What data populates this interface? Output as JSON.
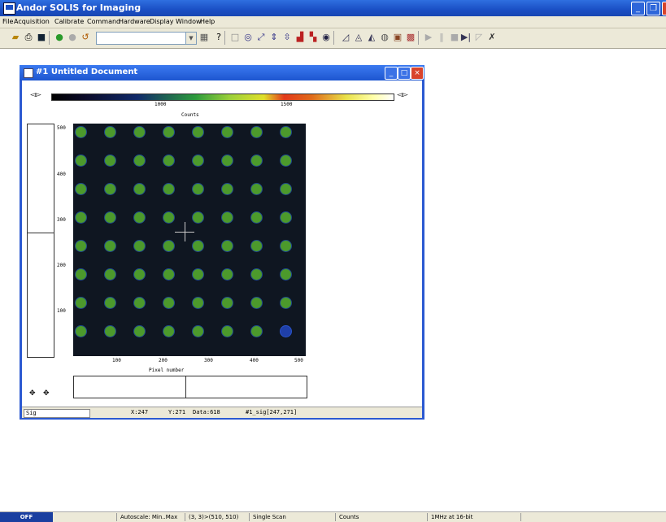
{
  "app": {
    "title": "Andor SOLIS for Imaging"
  },
  "menu": [
    "File",
    "Acquisition",
    "Calibrate",
    "Command",
    "Hardware",
    "Display",
    "Window",
    "Help"
  ],
  "document": {
    "title": "#1  Untitled Document",
    "colorbar_ticks": [
      "1000",
      "1500"
    ],
    "colorbar_label": "Counts",
    "y_ticks": [
      "500",
      "400",
      "300",
      "200",
      "100"
    ],
    "x_ticks": [
      "100",
      "200",
      "300",
      "400",
      "500"
    ],
    "x_label": "Pixel number",
    "status": {
      "sig": "Sig",
      "x": "X:247",
      "y": "Y:271",
      "data": "Data:618",
      "ref": "#1_sig[247,271]"
    }
  },
  "status_bar": {
    "mode": "OFF",
    "autoscale": "Autoscale: Min..Max",
    "region": "(3, 3)>(510, 510)",
    "scan": "Single Scan",
    "units": "Counts",
    "readout": "1MHz at 16-bit"
  },
  "colors": {
    "title_bar": "#1a4fc4",
    "spot_green": "#4c9a2c",
    "spot_blue": "#1f3fa8",
    "image_bg": "#0f1621"
  },
  "icons": [
    "open-icon",
    "print-icon",
    "save-icon",
    "acquire-icon",
    "record-icon",
    "undo-icon",
    "help-icon",
    "zoom-icon",
    "play-icon",
    "pause-icon",
    "stop-icon"
  ]
}
